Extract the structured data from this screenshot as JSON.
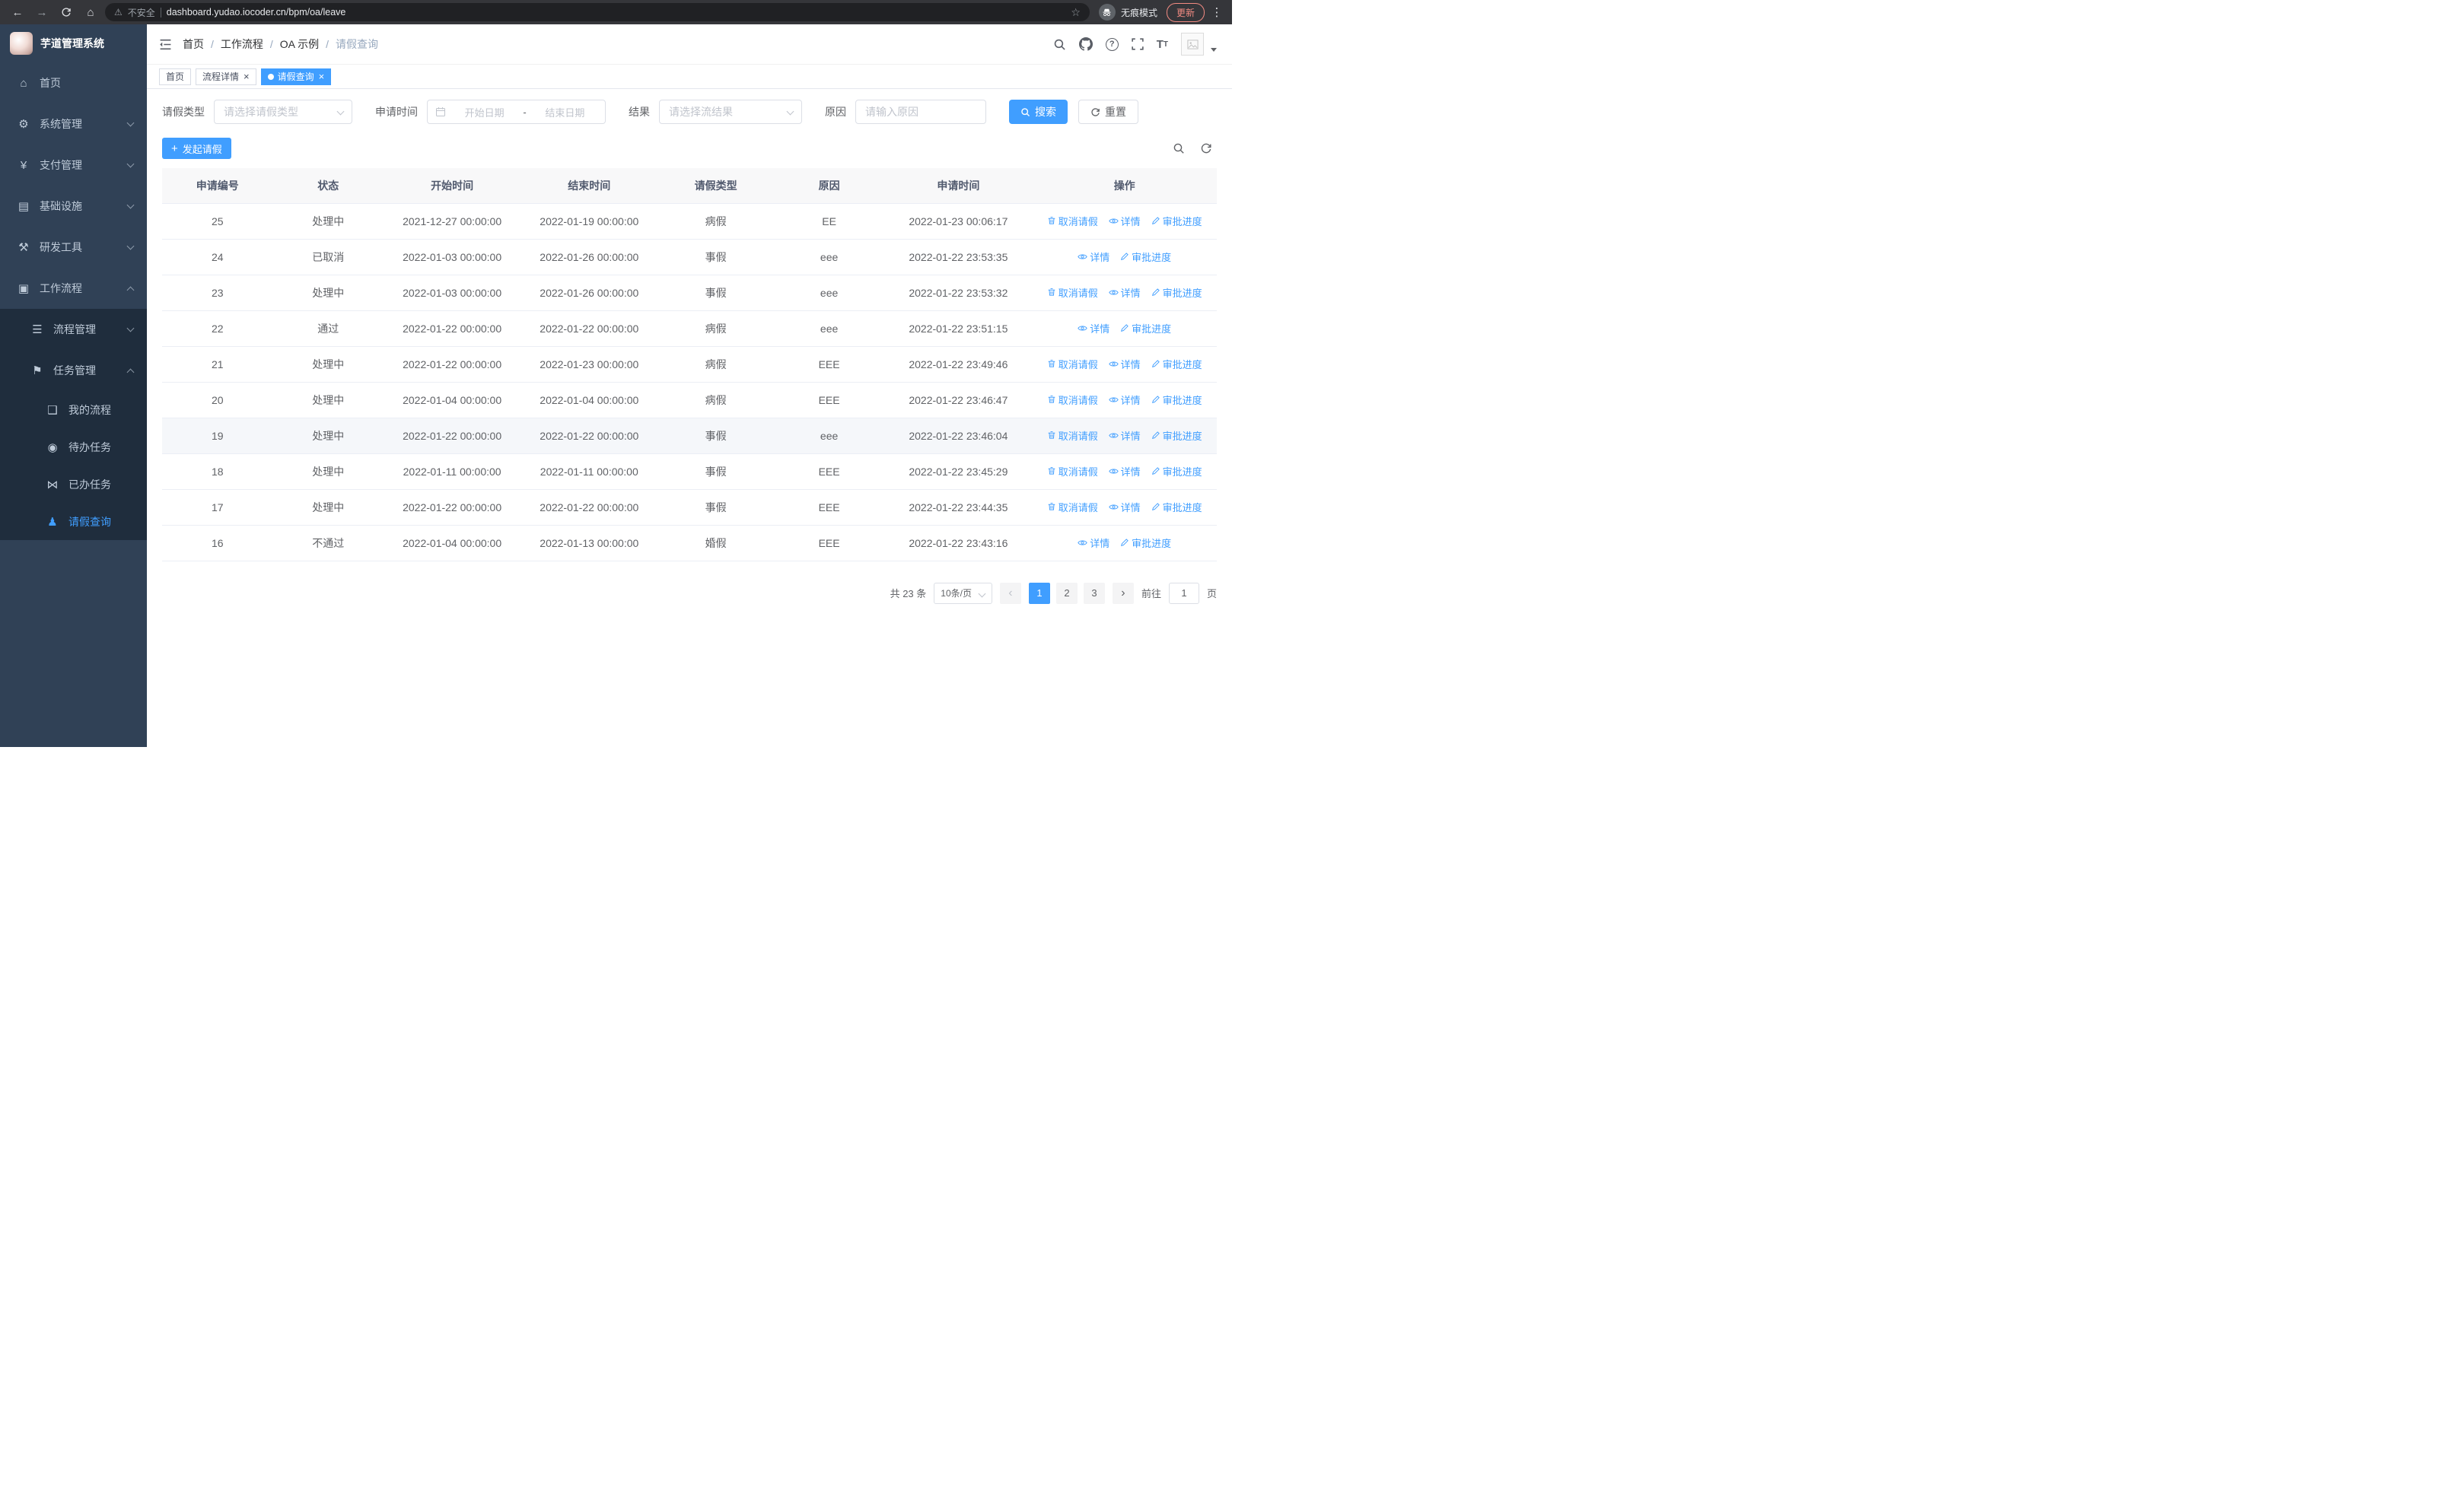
{
  "browser": {
    "security": "不安全",
    "url": "dashboard.yudao.iocoder.cn/bpm/oa/leave",
    "incognito": "无痕模式",
    "update": "更新"
  },
  "app": {
    "title": "芋道管理系统"
  },
  "sidebar": {
    "items": [
      {
        "name": "home",
        "label": "首页",
        "icon": "home-icon",
        "glyph": "⌂",
        "level": 1
      },
      {
        "name": "system-management",
        "label": "系统管理",
        "icon": "gear-icon",
        "glyph": "⚙",
        "level": 1,
        "chevron": "down"
      },
      {
        "name": "payment-management",
        "label": "支付管理",
        "icon": "yen-icon",
        "glyph": "¥",
        "level": 1,
        "chevron": "down"
      },
      {
        "name": "infrastructure",
        "label": "基础设施",
        "icon": "infrastructure-icon",
        "glyph": "▤",
        "level": 1,
        "chevron": "down"
      },
      {
        "name": "dev-tools",
        "label": "研发工具",
        "icon": "toolbox-icon",
        "glyph": "⚒",
        "level": 1,
        "chevron": "down"
      },
      {
        "name": "workflow",
        "label": "工作流程",
        "icon": "briefcase-icon",
        "glyph": "▣",
        "level": 1,
        "chevron": "up"
      },
      {
        "name": "process-management",
        "label": "流程管理",
        "icon": "list-icon",
        "glyph": "☰",
        "level": 2,
        "sub": true,
        "chevron": "down"
      },
      {
        "name": "task-management",
        "label": "任务管理",
        "icon": "flag-icon",
        "glyph": "⚑",
        "level": 2,
        "sub": true,
        "chevron": "up"
      },
      {
        "name": "my-process",
        "label": "我的流程",
        "icon": "chat-icon",
        "glyph": "❑",
        "level": 3,
        "sub": true
      },
      {
        "name": "todo-tasks",
        "label": "待办任务",
        "icon": "eye-icon",
        "glyph": "◉",
        "level": 3,
        "sub": true
      },
      {
        "name": "done-tasks",
        "label": "已办任务",
        "icon": "done-tasks-icon",
        "glyph": "⋈",
        "level": 3,
        "sub": true
      },
      {
        "name": "leave-query",
        "label": "请假查询",
        "icon": "user-icon",
        "glyph": "♟",
        "level": 3,
        "sub": true,
        "active": true
      }
    ]
  },
  "breadcrumb": [
    "首页",
    "工作流程",
    "OA 示例",
    "请假查询"
  ],
  "tabs": [
    {
      "label": "首页",
      "closable": false,
      "active": false
    },
    {
      "label": "流程详情",
      "closable": true,
      "active": false
    },
    {
      "label": "请假查询",
      "closable": true,
      "active": true
    }
  ],
  "filters": {
    "leave_type": {
      "label": "请假类型",
      "placeholder": "请选择请假类型"
    },
    "apply_time": {
      "label": "申请时间",
      "start_placeholder": "开始日期",
      "separator": "-",
      "end_placeholder": "结束日期"
    },
    "result": {
      "label": "结果",
      "placeholder": "请选择流结果"
    },
    "reason": {
      "label": "原因",
      "placeholder": "请输入原因"
    },
    "search": "搜索",
    "reset": "重置"
  },
  "toolbar": {
    "create": "发起请假"
  },
  "table": {
    "columns": [
      "申请编号",
      "状态",
      "开始时间",
      "结束时间",
      "请假类型",
      "原因",
      "申请时间",
      "操作"
    ],
    "actions": {
      "cancel": "取消请假",
      "detail": "详情",
      "progress": "审批进度"
    },
    "rows": [
      {
        "id": "25",
        "status": "处理中",
        "start": "2021-12-27 00:00:00",
        "end": "2022-01-19 00:00:00",
        "type": "病假",
        "reason": "EE",
        "applied": "2022-01-23 00:06:17",
        "can_cancel": true
      },
      {
        "id": "24",
        "status": "已取消",
        "start": "2022-01-03 00:00:00",
        "end": "2022-01-26 00:00:00",
        "type": "事假",
        "reason": "eee",
        "applied": "2022-01-22 23:53:35",
        "can_cancel": false
      },
      {
        "id": "23",
        "status": "处理中",
        "start": "2022-01-03 00:00:00",
        "end": "2022-01-26 00:00:00",
        "type": "事假",
        "reason": "eee",
        "applied": "2022-01-22 23:53:32",
        "can_cancel": true
      },
      {
        "id": "22",
        "status": "通过",
        "start": "2022-01-22 00:00:00",
        "end": "2022-01-22 00:00:00",
        "type": "病假",
        "reason": "eee",
        "applied": "2022-01-22 23:51:15",
        "can_cancel": false
      },
      {
        "id": "21",
        "status": "处理中",
        "start": "2022-01-22 00:00:00",
        "end": "2022-01-23 00:00:00",
        "type": "病假",
        "reason": "EEE",
        "applied": "2022-01-22 23:49:46",
        "can_cancel": true
      },
      {
        "id": "20",
        "status": "处理中",
        "start": "2022-01-04 00:00:00",
        "end": "2022-01-04 00:00:00",
        "type": "病假",
        "reason": "EEE",
        "applied": "2022-01-22 23:46:47",
        "can_cancel": true
      },
      {
        "id": "19",
        "status": "处理中",
        "start": "2022-01-22 00:00:00",
        "end": "2022-01-22 00:00:00",
        "type": "事假",
        "reason": "eee",
        "applied": "2022-01-22 23:46:04",
        "can_cancel": true,
        "highlight": true
      },
      {
        "id": "18",
        "status": "处理中",
        "start": "2022-01-11 00:00:00",
        "end": "2022-01-11 00:00:00",
        "type": "事假",
        "reason": "EEE",
        "applied": "2022-01-22 23:45:29",
        "can_cancel": true
      },
      {
        "id": "17",
        "status": "处理中",
        "start": "2022-01-22 00:00:00",
        "end": "2022-01-22 00:00:00",
        "type": "事假",
        "reason": "EEE",
        "applied": "2022-01-22 23:44:35",
        "can_cancel": true
      },
      {
        "id": "16",
        "status": "不通过",
        "start": "2022-01-04 00:00:00",
        "end": "2022-01-13 00:00:00",
        "type": "婚假",
        "reason": "EEE",
        "applied": "2022-01-22 23:43:16",
        "can_cancel": false
      }
    ]
  },
  "pagination": {
    "total": "共 23 条",
    "page_size": "10条/页",
    "pages": [
      "1",
      "2",
      "3"
    ],
    "current": "1",
    "prev": "‹",
    "next": "›",
    "goto_label": "前往",
    "goto_value": "1",
    "page_label": "页"
  },
  "colors": {
    "primary": "#409eff",
    "sidebar_bg": "#304156",
    "sidebar_sub_bg": "#1f2d3d",
    "update_accent": "#f28b82"
  }
}
